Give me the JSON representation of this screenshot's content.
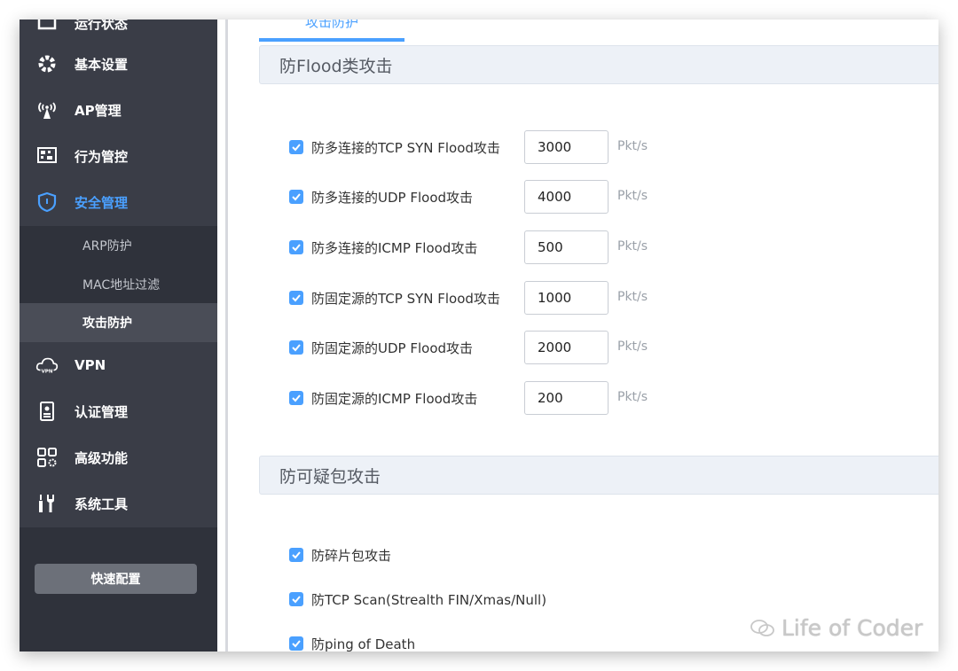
{
  "sidebar": {
    "top_partial_label": "运行状态",
    "items": [
      {
        "label": "基本设置",
        "icon": "gear-icon"
      },
      {
        "label": "AP管理",
        "icon": "antenna-icon"
      },
      {
        "label": "行为管控",
        "icon": "behavior-control-icon"
      },
      {
        "label": "安全管理",
        "icon": "shield-icon",
        "active": true
      },
      {
        "label": "VPN",
        "icon": "vpn-cloud-icon"
      },
      {
        "label": "认证管理",
        "icon": "auth-badge-icon"
      },
      {
        "label": "高级功能",
        "icon": "advanced-grid-icon"
      },
      {
        "label": "系统工具",
        "icon": "tools-icon"
      }
    ],
    "sub_items": [
      {
        "label": "ARP防护"
      },
      {
        "label": "MAC地址过滤"
      },
      {
        "label": "攻击防护",
        "active": true
      }
    ],
    "quick_config_label": "快速配置"
  },
  "main": {
    "tab_label": "攻击防护",
    "flood_section": {
      "title": "防Flood类攻击",
      "unit": "Pkt/s",
      "rows": [
        {
          "label": "防多连接的TCP SYN Flood攻击",
          "value": "3000",
          "checked": true
        },
        {
          "label": "防多连接的UDP Flood攻击",
          "value": "4000",
          "checked": true
        },
        {
          "label": "防多连接的ICMP Flood攻击",
          "value": "500",
          "checked": true
        },
        {
          "label": "防固定源的TCP SYN Flood攻击",
          "value": "1000",
          "checked": true
        },
        {
          "label": "防固定源的UDP Flood攻击",
          "value": "2000",
          "checked": true
        },
        {
          "label": "防固定源的ICMP Flood攻击",
          "value": "200",
          "checked": true
        }
      ]
    },
    "suspicious_section": {
      "title": "防可疑包攻击",
      "rows": [
        {
          "label": "防碎片包攻击",
          "checked": true
        },
        {
          "label": "防TCP Scan(Strealth FIN/Xmas/Null)",
          "checked": true
        },
        {
          "label": "防ping of Death",
          "checked": true
        }
      ]
    }
  },
  "watermark": "Life of Coder",
  "colors": {
    "accent": "#4aa0ff",
    "sidebar_bg": "#3a3d47",
    "section_bg": "#edf1f7"
  }
}
